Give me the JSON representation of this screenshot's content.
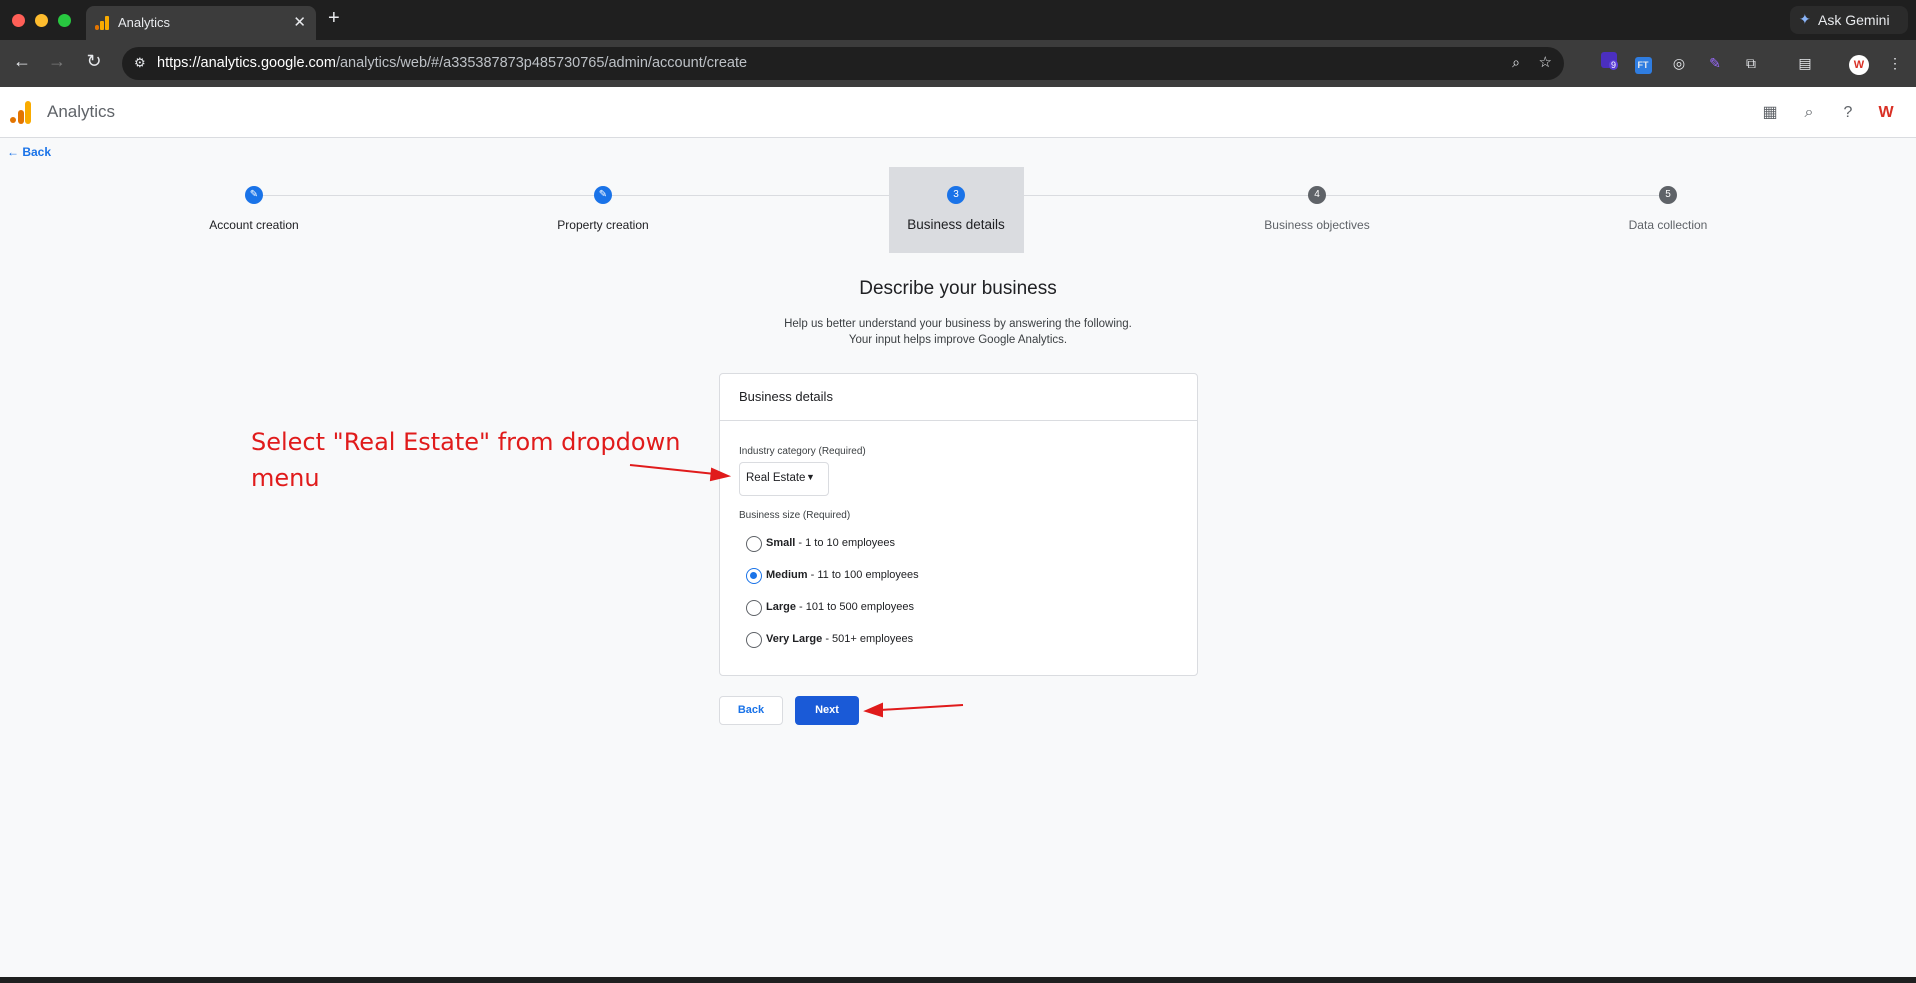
{
  "browser": {
    "tab_title": "Analytics",
    "new_tab_icon": "plus-icon",
    "gemini_label": "Ask Gemini",
    "url_host": "https://analytics.google.com",
    "url_path": "/analytics/web/#/a335387873p485730765/admin/account/create",
    "extension_badge": "9",
    "extension_ft": "FT",
    "profile_letter": "W"
  },
  "app": {
    "title": "Analytics",
    "back_link": "Back"
  },
  "stepper": {
    "steps": [
      {
        "number": "",
        "label": "Account creation",
        "state": "done"
      },
      {
        "number": "",
        "label": "Property creation",
        "state": "done"
      },
      {
        "number": "3",
        "label": "Business details",
        "state": "current"
      },
      {
        "number": "4",
        "label": "Business objectives",
        "state": "todo"
      },
      {
        "number": "5",
        "label": "Data collection",
        "state": "todo"
      }
    ]
  },
  "main": {
    "heading": "Describe your business",
    "subtitle_line1": "Help us better understand your business by answering the following.",
    "subtitle_line2": "Your input helps improve Google Analytics.",
    "card_title": "Business details",
    "industry_label": "Industry category (Required)",
    "industry_value": "Real Estate",
    "size_label": "Business size (Required)",
    "sizes": [
      {
        "name": "Small",
        "desc": " - 1 to 10 employees",
        "checked": false
      },
      {
        "name": "Medium",
        "desc": " - 11 to 100 employees",
        "checked": true
      },
      {
        "name": "Large",
        "desc": " - 101 to 500 employees",
        "checked": false
      },
      {
        "name": "Very Large",
        "desc": " - 501+ employees",
        "checked": false
      }
    ],
    "back_button": "Back",
    "next_button": "Next"
  },
  "annotation": {
    "text": "Select \"Real Estate\" from dropdown menu",
    "color": "#e01b1b"
  },
  "colors": {
    "accent": "#1a73e8",
    "primary_button": "#1a5ad7",
    "ga_orange": "#f9ab00",
    "ga_dark_orange": "#e37400"
  }
}
